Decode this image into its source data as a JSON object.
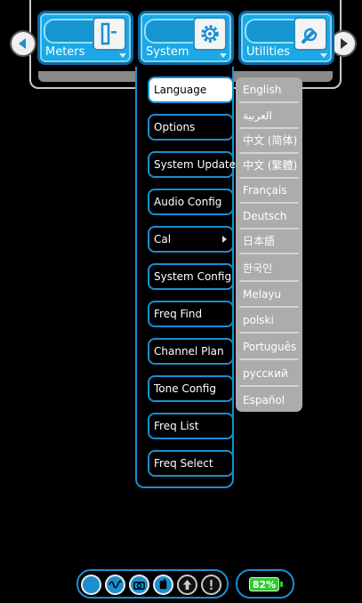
{
  "tabs": [
    {
      "label": "Meters",
      "icon": "meters-icon"
    },
    {
      "label": "System",
      "icon": "gear-icon"
    },
    {
      "label": "Utilities",
      "icon": "wrench-icon"
    }
  ],
  "system_menu": {
    "items": [
      {
        "label": "Language",
        "selected": true
      },
      {
        "label": "Options"
      },
      {
        "label": "System Update"
      },
      {
        "label": "Audio Config"
      },
      {
        "label": "Cal",
        "has_submenu": true
      },
      {
        "label": "System Config"
      },
      {
        "label": "Freq Find"
      },
      {
        "label": "Channel Plan"
      },
      {
        "label": "Tone Config"
      },
      {
        "label": "Freq List"
      },
      {
        "label": "Freq Select"
      }
    ]
  },
  "language_menu": {
    "items": [
      "English",
      "العربية",
      "中文 (简体)",
      "中文 (繁體)",
      "Français",
      "Deutsch",
      "日本語",
      "한국인",
      "Melayu",
      "polski",
      "Português",
      "русский",
      "Español"
    ]
  },
  "status": {
    "battery": "82%",
    "buttons": [
      "record-icon",
      "waveform-icon",
      "camera-icon",
      "phone-icon",
      "up-arrow-icon",
      "alert-icon"
    ]
  },
  "colors": {
    "accent": "#1a8fd0",
    "tab_fill": "#1aa9e6",
    "battery": "#2ecc2e",
    "lang_panel": "#acacac"
  }
}
